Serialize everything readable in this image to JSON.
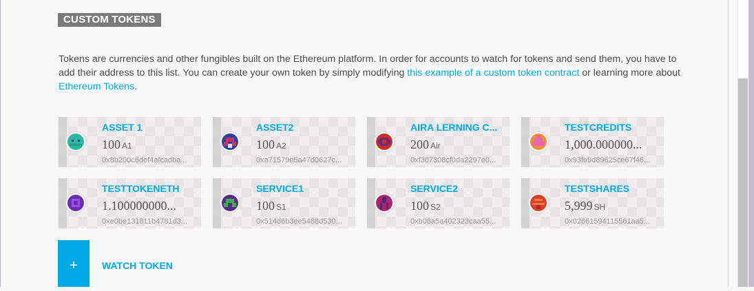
{
  "section": {
    "title": "CUSTOM TOKENS"
  },
  "description": {
    "part1": "Tokens are currencies and other fungibles built on the Ethereum platform. In order for accounts to watch for tokens and send them, you have to add their address to this list. You can create your own token by simply modifying ",
    "link1": "this example of a custom token contract",
    "part2": " or learning more about ",
    "link2": "Ethereum Tokens",
    "part3": "."
  },
  "tokens": [
    {
      "name": "ASSET 1",
      "balance": "100",
      "symbol": "A1",
      "address": "0x8b200c6def4afcadba...",
      "icon": "identicon-teal"
    },
    {
      "name": "ASSET2",
      "balance": "100",
      "symbol": "A2",
      "address": "0xa71579e5a47d0627c...",
      "icon": "identicon-navy-purple"
    },
    {
      "name": "AIRA LERNING C...",
      "balance": "200",
      "symbol": "Air",
      "address": "0xf307308cf0da2297e0...",
      "icon": "identicon-red-purple"
    },
    {
      "name": "TESTCREDITS",
      "balance": "1,000.000000...",
      "symbol": "",
      "address": "0x93fe9d89625ce67f46...",
      "icon": "identicon-pink-orange"
    },
    {
      "name": "TESTTOKENETH",
      "balance": "1.100000000...",
      "symbol": "",
      "address": "0xe0be131811b4781d3...",
      "icon": "identicon-purple"
    },
    {
      "name": "SERVICE1",
      "balance": "100",
      "symbol": "S1",
      "address": "0x514d6b3ee5488d530...",
      "icon": "identicon-green-purple"
    },
    {
      "name": "SERVICE2",
      "balance": "100",
      "symbol": "S2",
      "address": "0xb08a5a402323caa55...",
      "icon": "identicon-magenta"
    },
    {
      "name": "TESTSHARES",
      "balance": "5,999",
      "symbol": "SH",
      "address": "0x02661594115561aa5...",
      "icon": "identicon-red-orange"
    }
  ],
  "watch": {
    "plus": "+",
    "label": "WATCH TOKEN"
  },
  "colors": {
    "accent": "#00a9e6",
    "title_bg": "#7a7a7a",
    "card_bg": "#e6e4e4"
  }
}
